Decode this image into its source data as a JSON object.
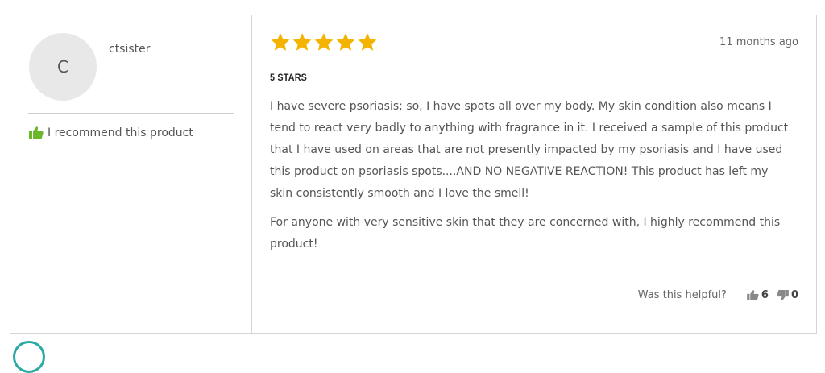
{
  "review": {
    "avatar_initial": "C",
    "username": "ctsister",
    "recommend_text": "I recommend this product",
    "rating": 5,
    "rating_max": 5,
    "star_color": "#f5b301",
    "recommend_icon_color": "#6bb82d",
    "date": "11 months ago",
    "title": "5 STARS",
    "paragraphs": [
      "I have severe psoriasis; so, I have spots all over my body. My skin condition also means I tend to react very badly to anything with fragrance in it. I received a sample of this product that I have used on areas that are not presently impacted by my psoriasis and I have used this product on psoriasis spots....AND NO NEGATIVE REACTION! This product has left my skin consistently smooth and I love the smell!",
      "For anyone with very sensitive skin that they are concerned with, I highly recommend this product!"
    ],
    "helpful_label": "Was this helpful?",
    "helpful_yes": "6",
    "helpful_no": "0"
  }
}
